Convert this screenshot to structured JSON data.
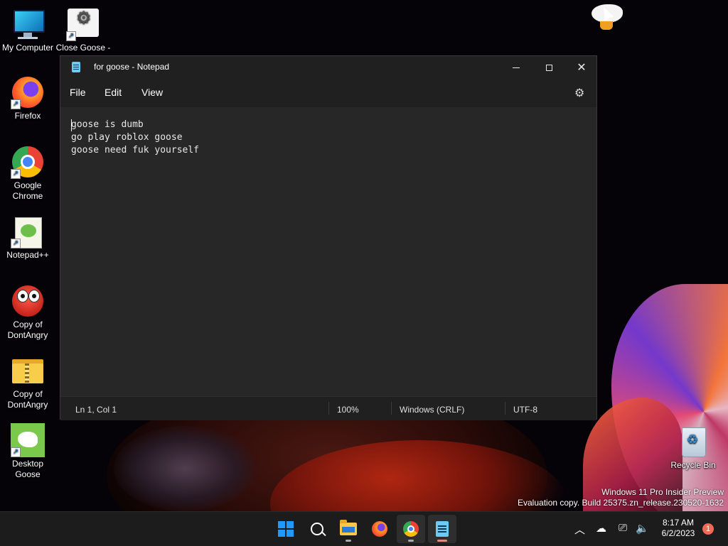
{
  "desktop": {
    "icons": [
      {
        "label": "My Computer"
      },
      {
        "label": "Close Goose - Shortcut"
      },
      {
        "label": "Firefox"
      },
      {
        "label": "Google Chrome"
      },
      {
        "label": "Notepad++"
      },
      {
        "label": "Copy of DontAngry"
      },
      {
        "label": "Copy of DontAngry"
      },
      {
        "label": "Desktop Goose"
      },
      {
        "label": "Recycle Bin"
      }
    ],
    "watermark": {
      "line1": "Windows 11 Pro Insider Preview",
      "line2": "Evaluation copy. Build 25375.zn_release.230520-1632"
    }
  },
  "notepad": {
    "title": "for goose - Notepad",
    "menu": {
      "file": "File",
      "edit": "Edit",
      "view": "View"
    },
    "content": [
      "goose is dumb",
      "go play roblox goose",
      "goose need fuk yourself"
    ],
    "status": {
      "position": "Ln 1, Col 1",
      "zoom": "100%",
      "line_ending": "Windows (CRLF)",
      "encoding": "UTF-8"
    }
  },
  "taskbar": {
    "clock": {
      "time": "8:17 AM",
      "date": "6/2/2023"
    },
    "notification_count": "1"
  },
  "colors": {
    "accent": "#1e9aff",
    "window_bg": "#202020",
    "editor_bg": "#272727",
    "taskbar_bg": "#1c1c1c"
  }
}
